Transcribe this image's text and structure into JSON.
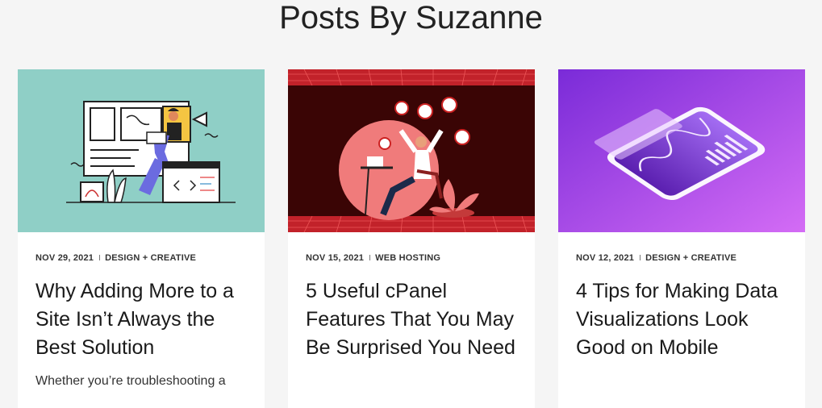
{
  "page": {
    "title": "Posts By Suzanne"
  },
  "colors": {
    "background": "#f5f5f5",
    "card": "#ffffff",
    "thumb_teal": "#8fcfc6",
    "thumb_red": "#5a0a0a",
    "thumb_purple": "#9a3fe6"
  },
  "posts": [
    {
      "date": "NOV 29, 2021",
      "category": "DESIGN + CREATIVE",
      "title": "Why Adding More to a Site Isn’t Always the Best Solution",
      "excerpt": "Whether you’re troubleshooting a",
      "thumbnail": "web-designer-illustration"
    },
    {
      "date": "NOV 15, 2021",
      "category": "WEB HOSTING",
      "title": "5 Useful cPanel Features That You May Be Surprised You Need",
      "thumbnail": "celebrating-user-illustration"
    },
    {
      "date": "NOV 12, 2021",
      "category": "DESIGN + CREATIVE",
      "title": "4 Tips for Making Data Visualizations Look Good on Mobile",
      "thumbnail": "mobile-chart-illustration"
    }
  ]
}
